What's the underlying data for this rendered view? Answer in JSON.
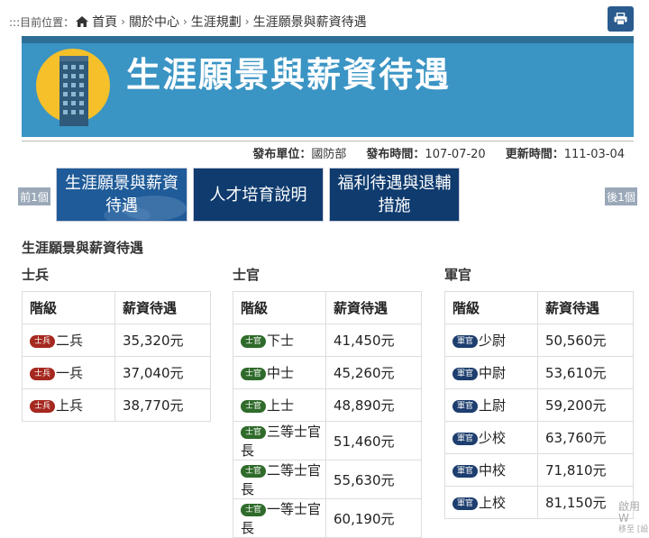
{
  "breadcrumb": {
    "prefix": ":::目前位置：",
    "items": [
      "首頁",
      "關於中心",
      "生涯規劃",
      "生涯願景與薪資待遇"
    ]
  },
  "banner": {
    "title": "生涯願景與薪資待遇"
  },
  "meta": {
    "unit_label": "發布單位：",
    "unit": "國防部",
    "published_label": "發布時間：",
    "published": "107-07-20",
    "updated_label": "更新時間：",
    "updated": "111-03-04"
  },
  "nav": {
    "prev": "前1個",
    "next": "後1個",
    "tiles": [
      "生涯願景與薪資待遇",
      "人才培育說明",
      "福利待遇與退輔措施"
    ]
  },
  "content": {
    "section_title": "生涯願景與薪資待遇",
    "header_rank": "階級",
    "header_pay": "薪資待遇",
    "groups": [
      {
        "title": "士兵",
        "badge": "士兵",
        "color": "#a5281f",
        "rows": [
          {
            "rank": "二兵",
            "pay": "35,320元"
          },
          {
            "rank": "一兵",
            "pay": "37,040元"
          },
          {
            "rank": "上兵",
            "pay": "38,770元"
          }
        ]
      },
      {
        "title": "士官",
        "badge": "士官",
        "color": "#2f6b2a",
        "rows": [
          {
            "rank": "下士",
            "pay": "41,450元"
          },
          {
            "rank": "中士",
            "pay": "45,260元"
          },
          {
            "rank": "上士",
            "pay": "48,890元"
          },
          {
            "rank": "三等士官長",
            "pay": "51,460元"
          },
          {
            "rank": "二等士官長",
            "pay": "55,630元"
          },
          {
            "rank": "一等士官長",
            "pay": "60,190元"
          }
        ]
      },
      {
        "title": "軍官",
        "badge": "軍官",
        "color": "#1d3e6e",
        "rows": [
          {
            "rank": "少尉",
            "pay": "50,560元"
          },
          {
            "rank": "中尉",
            "pay": "53,610元"
          },
          {
            "rank": "上尉",
            "pay": "59,200元"
          },
          {
            "rank": "少校",
            "pay": "63,760元"
          },
          {
            "rank": "中校",
            "pay": "71,810元"
          },
          {
            "rank": "上校",
            "pay": "81,150元"
          }
        ]
      }
    ]
  },
  "watermark": {
    "line1": "啟用 W",
    "line2": "移至 [設"
  },
  "icons": {
    "home": "home-icon",
    "print": "print-icon",
    "separator": "chevron-right-icon"
  }
}
